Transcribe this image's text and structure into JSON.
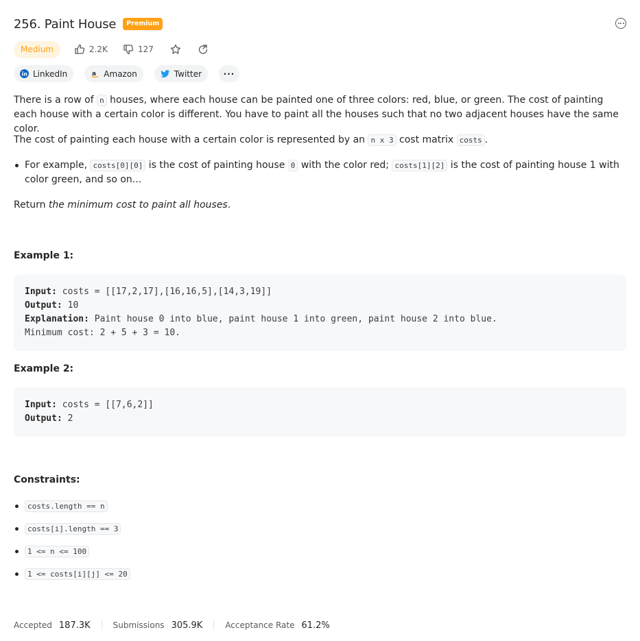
{
  "problem": {
    "title": "256. Paint House",
    "premium_badge": "Premium",
    "difficulty": "Medium",
    "likes": "2.2K",
    "dislikes": "127"
  },
  "companies": [
    {
      "name": "LinkedIn",
      "icon": "linkedin-icon"
    },
    {
      "name": "Amazon",
      "icon": "amazon-icon"
    },
    {
      "name": "Twitter",
      "icon": "twitter-icon"
    }
  ],
  "more_label": "···",
  "description": {
    "p1_a": "There is a row of ",
    "p1_code": "n",
    "p1_b": " houses, where each house can be painted one of three colors: red, blue, or green. The cost of painting each house with a certain color is different. You have to paint all the houses such that no two adjacent houses have the same color.",
    "p2_a": "The cost of painting each house with a certain color is represented by an ",
    "p2_code1": "n x 3",
    "p2_b": " cost matrix ",
    "p2_code2": "costs",
    "p2_c": ".",
    "bullet_a": "For example, ",
    "bullet_code1": "costs[0][0]",
    "bullet_b": " is the cost of painting house ",
    "bullet_code2": "0",
    "bullet_c": " with the color red; ",
    "bullet_code3": "costs[1][2]",
    "bullet_d": " is the cost of painting house 1 with color green, and so on...",
    "return_a": "Return ",
    "return_em": "the minimum cost to paint all houses",
    "return_b": "."
  },
  "example1": {
    "title": "Example 1:",
    "input_label": "Input:",
    "input": " costs = [[17,2,17],[16,16,5],[14,3,19]]",
    "output_label": "Output:",
    "output": " 10",
    "explanation_label": "Explanation:",
    "explanation": " Paint house 0 into blue, paint house 1 into green, paint house 2 into blue.",
    "explanation2": "Minimum cost: 2 + 5 + 3 = 10."
  },
  "example2": {
    "title": "Example 2:",
    "input_label": "Input:",
    "input": " costs = [[7,6,2]]",
    "output_label": "Output:",
    "output": " 2"
  },
  "constraints": {
    "title": "Constraints:",
    "items": [
      "costs.length == n",
      "costs[i].length == 3",
      "1 <= n <= 100",
      "1 <= costs[i][j] <= 20"
    ]
  },
  "stats": {
    "accepted_label": "Accepted",
    "accepted": "187.3K",
    "submissions_label": "Submissions",
    "submissions": "305.9K",
    "rate_label": "Acceptance Rate",
    "rate": "61.2%"
  },
  "colors": {
    "accent": "#ffa116",
    "difficulty_bg": "#fff4e0",
    "code_bg": "#f7f8fa"
  }
}
